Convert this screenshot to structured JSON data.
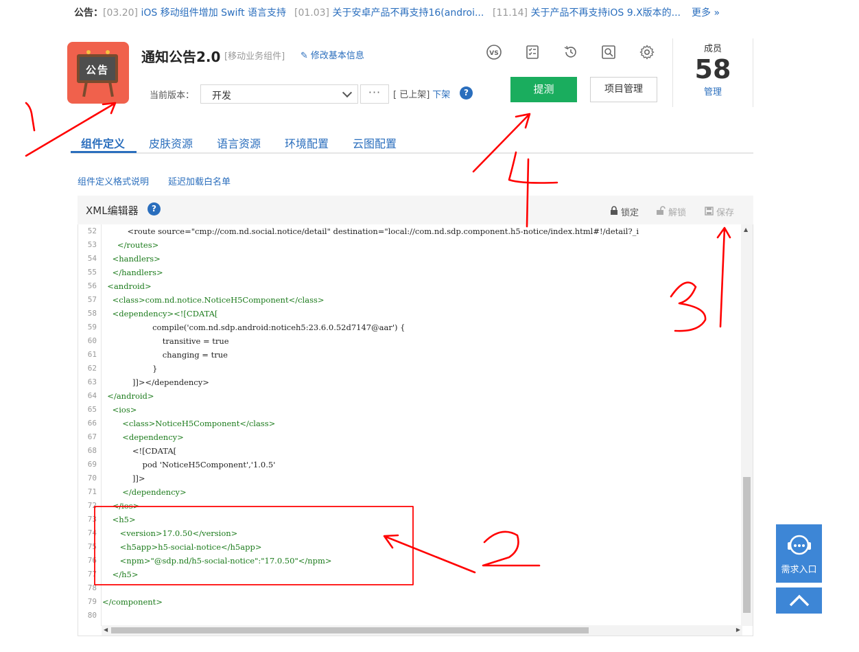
{
  "notice": {
    "label": "公告：",
    "items": [
      {
        "date": "[03.20]",
        "text": " iOS 移动组件增加 Swift 语言支持"
      },
      {
        "date": "[01.03]",
        "text": " 关于安卓产品不再支持16(androi..."
      },
      {
        "date": "[11.14]",
        "text": " 关于产品不再支持iOS 9.X版本的..."
      }
    ],
    "more": "更多 »"
  },
  "component": {
    "icon_text": "公告",
    "title": "通知公告2.0",
    "type": "[移动业务组件]",
    "edit_label": "修改基本信息"
  },
  "version": {
    "label": "当前版本：",
    "selected": "开发",
    "more_label": "···",
    "status": "[ 已上架]",
    "offline_label": "下架",
    "help": "?"
  },
  "toolbar": {
    "icons": [
      "vs-compare-icon",
      "checklist-icon",
      "history-icon",
      "search-doc-icon",
      "settings-icon"
    ],
    "submit_label": "提测",
    "manage_label": "项目管理"
  },
  "members": {
    "label": "成员",
    "count": "58",
    "manage": "管理"
  },
  "tabs": [
    "组件定义",
    "皮肤资源",
    "语言资源",
    "环境配置",
    "云图配置"
  ],
  "sublinks": [
    "组件定义格式说明",
    "延迟加载白名单"
  ],
  "editor": {
    "title": "XML编辑器",
    "help": "?",
    "lock": "锁定",
    "unlock": "解锁",
    "save": "保存",
    "lines": [
      {
        "n": "52",
        "text": "          <route source=\"cmp://com.nd.social.notice/detail\" destination=\"local://com.nd.sdp.component.h5-notice/index.html#!/detail?_i"
      },
      {
        "n": "53",
        "text": "      </routes>"
      },
      {
        "n": "54",
        "text": "    <handlers>"
      },
      {
        "n": "55",
        "text": "    </handlers>"
      },
      {
        "n": "56",
        "text": "  <android>"
      },
      {
        "n": "57",
        "text": "    <class>com.nd.notice.NoticeH5Component</class>"
      },
      {
        "n": "58",
        "text": "    <dependency><![CDATA["
      },
      {
        "n": "59",
        "text": "                    compile('com.nd.sdp.android:noticeh5:23.6.0.52d7147@aar') {"
      },
      {
        "n": "60",
        "text": "                        transitive = true"
      },
      {
        "n": "61",
        "text": "                        changing = true"
      },
      {
        "n": "62",
        "text": "                    }"
      },
      {
        "n": "63",
        "text": "            ]]></dependency>"
      },
      {
        "n": "64",
        "text": "  </android>"
      },
      {
        "n": "65",
        "text": "    <ios>"
      },
      {
        "n": "66",
        "text": "        <class>NoticeH5Component</class>"
      },
      {
        "n": "67",
        "text": "        <dependency>"
      },
      {
        "n": "68",
        "text": "            <![CDATA["
      },
      {
        "n": "69",
        "text": "                pod 'NoticeH5Component','1.0.5'"
      },
      {
        "n": "70",
        "text": "            ]]>"
      },
      {
        "n": "71",
        "text": "        </dependency>"
      },
      {
        "n": "72",
        "text": "    </ios>"
      },
      {
        "n": "73",
        "text": "    <h5>"
      },
      {
        "n": "74",
        "text": "       <version>17.0.50</version>"
      },
      {
        "n": "75",
        "text": "       <h5app>h5-social-notice</h5app>"
      },
      {
        "n": "76",
        "text": "       <npm>\"@sdp.nd/h5-social-notice\":\"17.0.50\"</npm>"
      },
      {
        "n": "77",
        "text": "    </h5>"
      },
      {
        "n": "78",
        "text": ""
      },
      {
        "n": "79",
        "text": "</component>"
      },
      {
        "n": "80",
        "text": ""
      }
    ]
  },
  "float": {
    "request_label": "需求入口"
  },
  "annotations": {
    "labels": [
      "1",
      "2",
      "3",
      "4"
    ],
    "color": "#ff0000"
  }
}
